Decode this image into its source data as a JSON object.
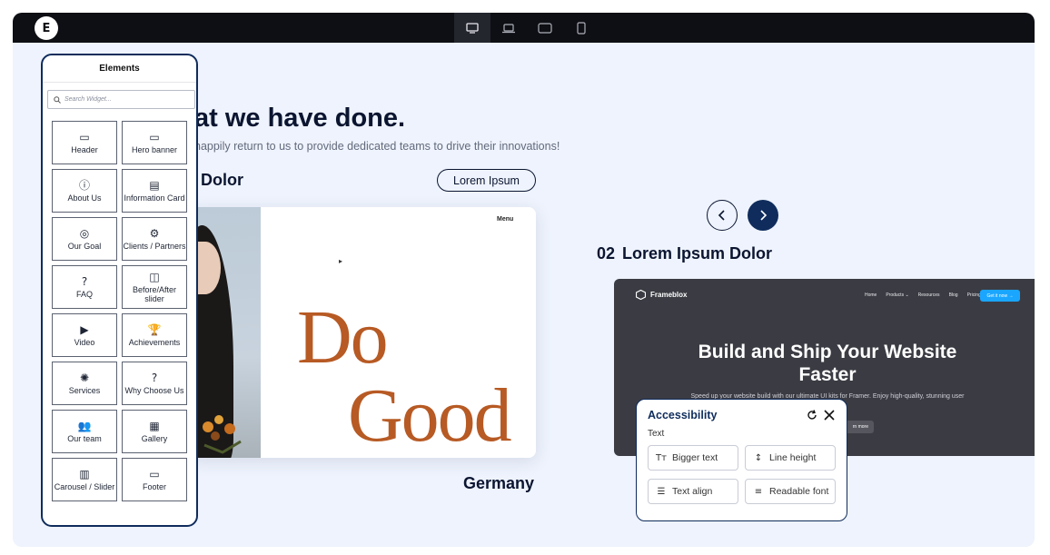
{
  "topbar": {
    "logo_text": "E",
    "devices": [
      {
        "name": "desktop",
        "icon": "desktop-icon",
        "active": true
      },
      {
        "name": "laptop",
        "icon": "laptop-icon",
        "active": false
      },
      {
        "name": "tablet",
        "icon": "tablet-icon",
        "active": false
      },
      {
        "name": "mobile",
        "icon": "mobile-icon",
        "active": false
      }
    ]
  },
  "page": {
    "headline": "at we have done.",
    "subline": "happily return to us to provide dedicated teams to drive their innovations!",
    "item1_title": "Dolor",
    "pill_button": "Lorem Ipsum",
    "card1": {
      "menu": "Menu",
      "word1": "Do",
      "word2": "Good",
      "caption": "Germany"
    },
    "item2_number": "02",
    "item2_title": "Lorem Ipsum Dolor",
    "card2": {
      "brand": "Frameblox",
      "nav": [
        "Home",
        "Products ⌄",
        "Resources",
        "Blog",
        "Pricing"
      ],
      "cta": "Get it now →",
      "title": "Build and Ship Your Website Faster",
      "subtitle": "Speed up your website build with our ultimate UI kits for Framer. Enjoy high-quality, stunning user experience.",
      "learn": "rn more"
    }
  },
  "accessibility": {
    "title": "Accessibility",
    "section": "Text",
    "buttons": [
      {
        "label": "Bigger text",
        "icon": "Tт"
      },
      {
        "label": "Line height",
        "icon": "↕"
      },
      {
        "label": "Text align",
        "icon": "☰"
      },
      {
        "label": "Readable font",
        "icon": "≡"
      }
    ]
  },
  "elements_panel": {
    "title": "Elements",
    "search_placeholder": "Search Widget...",
    "tiles": [
      {
        "label": "Header",
        "icon": "▭"
      },
      {
        "label": "Hero banner",
        "icon": "▭"
      },
      {
        "label": "About Us",
        "icon": "ⓘ"
      },
      {
        "label": "Information Card",
        "icon": "▤"
      },
      {
        "label": "Our Goal",
        "icon": "◎"
      },
      {
        "label": "Clients / Partners",
        "icon": "⚙"
      },
      {
        "label": "FAQ",
        "icon": "?"
      },
      {
        "label": "Before/After slider",
        "icon": "◫"
      },
      {
        "label": "Video",
        "icon": "▶"
      },
      {
        "label": "Achievements",
        "icon": "🏆"
      },
      {
        "label": "Services",
        "icon": "✺"
      },
      {
        "label": "Why Choose Us",
        "icon": "?"
      },
      {
        "label": "Our team",
        "icon": "👥"
      },
      {
        "label": "Gallery",
        "icon": "▦"
      },
      {
        "label": "Carousel / Slider",
        "icon": "▥"
      },
      {
        "label": "Footer",
        "icon": "▭"
      }
    ]
  }
}
